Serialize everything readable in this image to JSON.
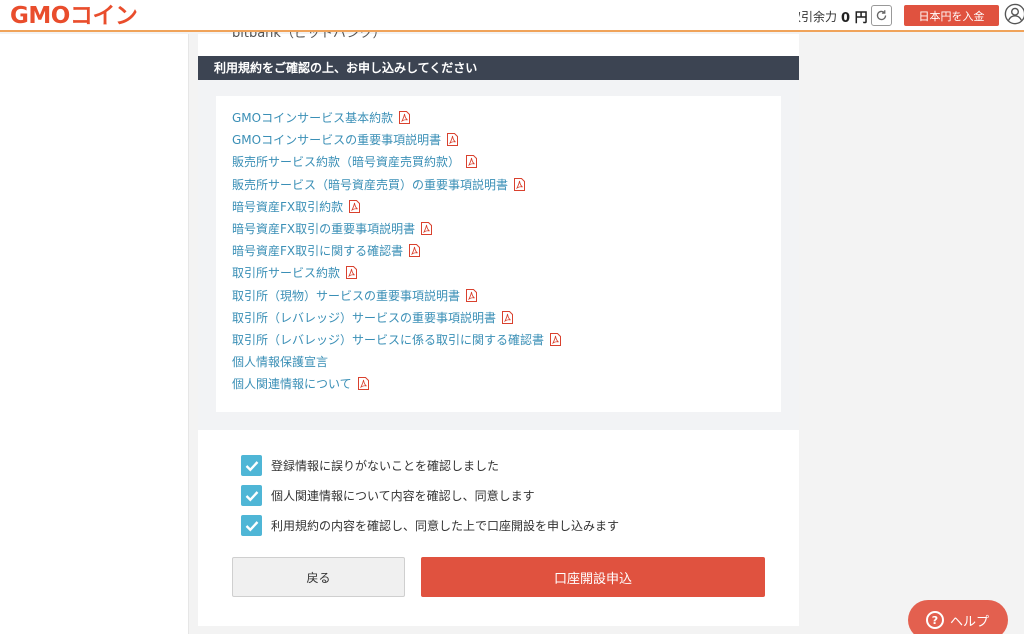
{
  "header": {
    "logo": "GMOコイン",
    "balance_label": "取引余力",
    "balance_value": "0 円",
    "deposit_button": "日本円を入金"
  },
  "cut_off_text": "bitbank（ビットバンク）",
  "section_title": "利用規約をご確認の上、お申し込みしてください",
  "terms": [
    {
      "label": "GMOコインサービス基本約款",
      "pdf": true
    },
    {
      "label": "GMOコインサービスの重要事項説明書",
      "pdf": true
    },
    {
      "label": "販売所サービス約款（暗号資産売買約款）",
      "pdf": true
    },
    {
      "label": "販売所サービス（暗号資産売買）の重要事項説明書",
      "pdf": true
    },
    {
      "label": "暗号資産FX取引約款",
      "pdf": true
    },
    {
      "label": "暗号資産FX取引の重要事項説明書",
      "pdf": true
    },
    {
      "label": "暗号資産FX取引に関する確認書",
      "pdf": true
    },
    {
      "label": "取引所サービス約款",
      "pdf": true
    },
    {
      "label": "取引所（現物）サービスの重要事項説明書",
      "pdf": true
    },
    {
      "label": "取引所（レバレッジ）サービスの重要事項説明書",
      "pdf": true
    },
    {
      "label": "取引所（レバレッジ）サービスに係る取引に関する確認書",
      "pdf": true
    },
    {
      "label": "個人情報保護宣言",
      "pdf": false
    },
    {
      "label": "個人関連情報について",
      "pdf": true
    }
  ],
  "confirmations": [
    {
      "label": "登録情報に誤りがないことを確認しました",
      "checked": true
    },
    {
      "label": "個人関連情報について内容を確認し、同意します",
      "checked": true
    },
    {
      "label": "利用規約の内容を確認し、同意した上で口座開設を申し込みます",
      "checked": true
    }
  ],
  "buttons": {
    "back": "戻る",
    "apply": "口座開設申込",
    "help": "ヘルプ"
  },
  "colors": {
    "brand": "#e94d2c",
    "accent_button": "#e0523f",
    "link": "#3a8fb6",
    "checkbox": "#4fb6d6",
    "section_bar": "#3c4452"
  }
}
